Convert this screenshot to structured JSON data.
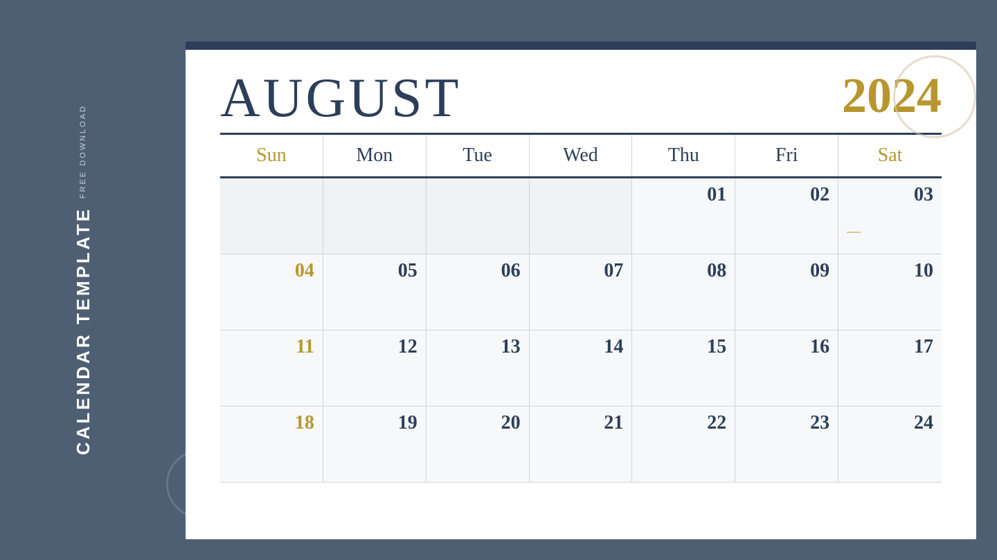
{
  "sidebar": {
    "free_download_label": "FREE DOWNLOAD",
    "calendar_template_label": "CALENDAR TEMPLATE"
  },
  "calendar": {
    "month": "AUGUST",
    "year": "2024",
    "days_of_week": [
      {
        "label": "Sun",
        "type": "weekend"
      },
      {
        "label": "Mon",
        "type": "weekday"
      },
      {
        "label": "Tue",
        "type": "weekday"
      },
      {
        "label": "Wed",
        "type": "weekday"
      },
      {
        "label": "Thu",
        "type": "weekday"
      },
      {
        "label": "Fri",
        "type": "weekday"
      },
      {
        "label": "Sat",
        "type": "weekend"
      }
    ],
    "weeks": [
      [
        {
          "num": "",
          "empty": true
        },
        {
          "num": "",
          "empty": true
        },
        {
          "num": "",
          "empty": true
        },
        {
          "num": "",
          "empty": true
        },
        {
          "num": "01",
          "empty": false,
          "type": "weekday"
        },
        {
          "num": "02",
          "empty": false,
          "type": "weekday"
        },
        {
          "num": "03",
          "empty": false,
          "type": "saturday"
        }
      ],
      [
        {
          "num": "04",
          "empty": false,
          "type": "sunday"
        },
        {
          "num": "05",
          "empty": false,
          "type": "weekday"
        },
        {
          "num": "06",
          "empty": false,
          "type": "weekday"
        },
        {
          "num": "07",
          "empty": false,
          "type": "weekday"
        },
        {
          "num": "08",
          "empty": false,
          "type": "weekday"
        },
        {
          "num": "09",
          "empty": false,
          "type": "weekday"
        },
        {
          "num": "10",
          "empty": false,
          "type": "saturday"
        }
      ],
      [
        {
          "num": "11",
          "empty": false,
          "type": "sunday"
        },
        {
          "num": "12",
          "empty": false,
          "type": "weekday"
        },
        {
          "num": "13",
          "empty": false,
          "type": "weekday"
        },
        {
          "num": "14",
          "empty": false,
          "type": "weekday"
        },
        {
          "num": "15",
          "empty": false,
          "type": "weekday"
        },
        {
          "num": "16",
          "empty": false,
          "type": "weekday"
        },
        {
          "num": "17",
          "empty": false,
          "type": "saturday"
        }
      ],
      [
        {
          "num": "18",
          "empty": false,
          "type": "sunday"
        },
        {
          "num": "19",
          "empty": false,
          "type": "weekday"
        },
        {
          "num": "20",
          "empty": false,
          "type": "weekday"
        },
        {
          "num": "21",
          "empty": false,
          "type": "weekday"
        },
        {
          "num": "22",
          "empty": false,
          "type": "weekday"
        },
        {
          "num": "23",
          "empty": false,
          "type": "weekday"
        },
        {
          "num": "24",
          "empty": false,
          "type": "saturday"
        }
      ]
    ]
  },
  "colors": {
    "background": "#4f5f73",
    "dark_navy": "#2c3e5a",
    "gold": "#b8962e",
    "white": "#ffffff",
    "cell_bg": "#f7f8f9"
  }
}
